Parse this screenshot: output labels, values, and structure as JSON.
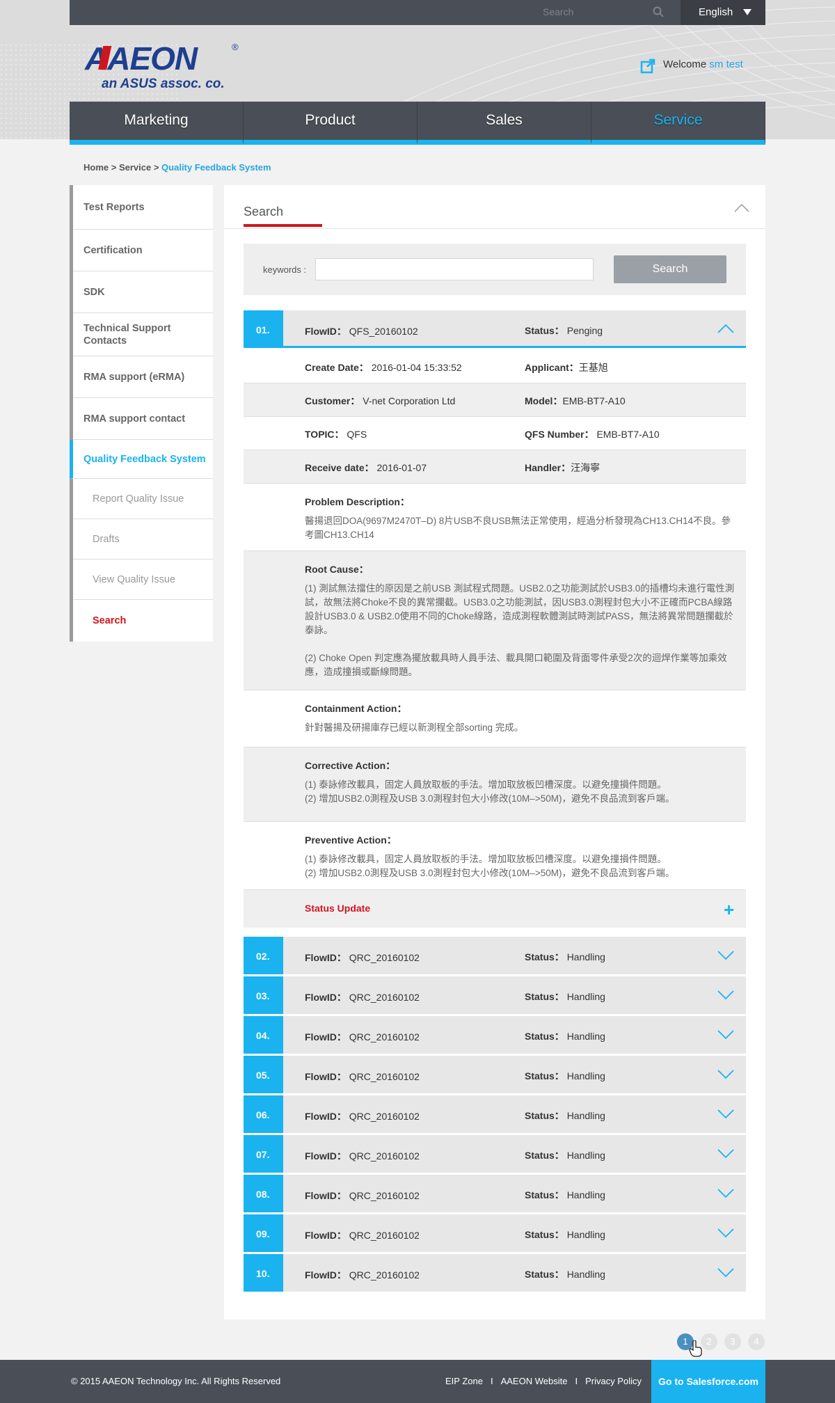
{
  "header": {
    "search_placeholder": "Search",
    "language": "English",
    "logo_text": "AAEON",
    "logo_tagline": "an ASUS assoc. co.",
    "welcome_label": "Welcome",
    "user_name": "sm test"
  },
  "nav": [
    "Marketing",
    "Product",
    "Sales",
    "Service"
  ],
  "breadcrumb": {
    "home": "Home",
    "sep1": " > ",
    "service": "Service",
    "sep2": " > ",
    "current": "Quality Feedback System"
  },
  "sidebar": {
    "items": [
      "Test Reports",
      "Certification",
      "SDK",
      "Technical Support Contacts",
      "RMA support (eRMA)",
      "RMA support contact",
      "Quality Feedback System"
    ],
    "sub_items": [
      "Report Quality Issue",
      "Drafts",
      "View Quality Issue",
      "Search"
    ]
  },
  "panel": {
    "title": "Search",
    "keywords_label": "keywords :",
    "search_button": "Search"
  },
  "record": {
    "num": "01.",
    "flow_label": "FlowID：",
    "flow_id": "QFS_20160102",
    "status_label": "Status：",
    "status": "Penging",
    "create_label": "Create Date：",
    "create_date": "2016-01-04 15:33:52",
    "applicant_label": "Applicant：",
    "applicant": "王基旭",
    "customer_label": "Customer：",
    "customer": "V-net Corporation Ltd",
    "model_label": "Model：",
    "model": "EMB-BT7-A10",
    "topic_label": "TOPIC：",
    "topic": "QFS",
    "qfs_label": "QFS Number：",
    "qfs_number": "EMB-BT7-A10",
    "receive_label": "Receive date：",
    "receive_date": "2016-01-07",
    "handler_label": "Handler：",
    "handler": "汪海寧",
    "problem_title": "Problem Description：",
    "problem_text": "醫揚退回DOA(9697M2470T–D) 8片USB不良USB無法正常使用，經過分析發現為CH13.CH14不良。參考圖CH13.CH14",
    "root_title": "Root Cause：",
    "root_text1": "(1) 測試無法擋住的原因是之前USB 測試程式問題。USB2.0之功能測試於USB3.0的插槽均未進行電性測試，故無法將Choke不良的異常攔截。USB3.0之功能測試，因USB3.0測程封包大小不正確而PCBA線路設計USB3.0 & USB2.0使用不同的Choke線路，造成測程軟體測試時測試PASS，無法將異常問題攔截於泰詠。",
    "root_text2": "(2) Choke Open 判定應為擺放載具時人員手法、載具開口範圍及背面零件承受2次的迴焊作業等加乘效應，造成撞損或斷線問題。",
    "containment_title": "Containment Action：",
    "containment_text": "針對醫揚及研揚庫存已經以新測程全部sorting 完成。",
    "corrective_title": "Corrective Action：",
    "corrective_text1": "(1) 泰詠修改載具，固定人員放取板的手法。增加取放板凹槽深度。以避免撞損件問題。",
    "corrective_text2": "(2) 增加USB2.0測程及USB 3.0測程封包大小修改(10M–>50M)，避免不良品流到客戶端。",
    "preventive_title": "Preventive Action：",
    "preventive_text1": "(1) 泰詠修改載具，固定人員放取板的手法。增加取放板凹槽深度。以避免撞損件問題。",
    "preventive_text2": "(2) 增加USB2.0測程及USB 3.0測程封包大小修改(10M–>50M)，避免不良品流到客戶端。",
    "status_update": "Status Update",
    "plus": "+"
  },
  "other_records": [
    {
      "num": "02.",
      "flow_id": "QRC_20160102",
      "status": "Handling"
    },
    {
      "num": "03.",
      "flow_id": "QRC_20160102",
      "status": "Handling"
    },
    {
      "num": "04.",
      "flow_id": "QRC_20160102",
      "status": "Handling"
    },
    {
      "num": "05.",
      "flow_id": "QRC_20160102",
      "status": "Handling"
    },
    {
      "num": "06.",
      "flow_id": "QRC_20160102",
      "status": "Handling"
    },
    {
      "num": "07.",
      "flow_id": "QRC_20160102",
      "status": "Handling"
    },
    {
      "num": "08.",
      "flow_id": "QRC_20160102",
      "status": "Handling"
    },
    {
      "num": "09.",
      "flow_id": "QRC_20160102",
      "status": "Handling"
    },
    {
      "num": "10.",
      "flow_id": "QRC_20160102",
      "status": "Handling"
    }
  ],
  "pagination": [
    "1",
    "2",
    "3",
    "4"
  ],
  "footer": {
    "copyright": "© 2015 AAEON Technology Inc. All Rights Reserved",
    "links": [
      "EIP Zone",
      "AAEON Website",
      "Privacy Policy"
    ],
    "separator": "I",
    "salesforce": "Go to Salesforce.com"
  },
  "colors": {
    "accent": "#1ab3f0",
    "red": "#d0151d",
    "nav": "#4a4f57",
    "logo_blue": "#1e3f8f",
    "logo_red": "#d0151d"
  }
}
